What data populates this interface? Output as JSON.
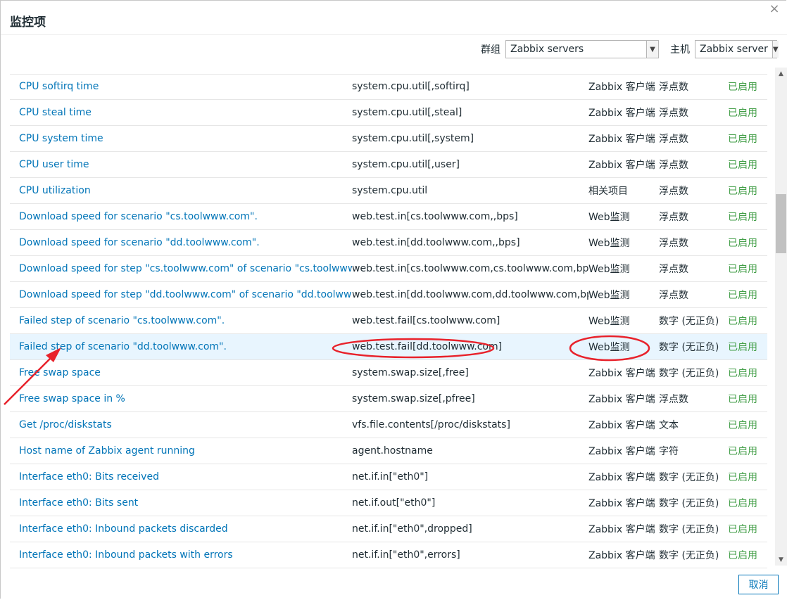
{
  "dialog": {
    "title": "监控项",
    "close_symbol": "×"
  },
  "filters": {
    "group_label": "群组",
    "group_value": "Zabbix servers",
    "host_label": "主机",
    "host_value": "Zabbix server"
  },
  "table": {
    "rows": [
      {
        "name": "CPU softirq time",
        "key": "system.cpu.util[,softirq]",
        "type": "Zabbix 客户端",
        "value_type": "浮点数",
        "status": "已启用"
      },
      {
        "name": "CPU steal time",
        "key": "system.cpu.util[,steal]",
        "type": "Zabbix 客户端",
        "value_type": "浮点数",
        "status": "已启用"
      },
      {
        "name": "CPU system time",
        "key": "system.cpu.util[,system]",
        "type": "Zabbix 客户端",
        "value_type": "浮点数",
        "status": "已启用"
      },
      {
        "name": "CPU user time",
        "key": "system.cpu.util[,user]",
        "type": "Zabbix 客户端",
        "value_type": "浮点数",
        "status": "已启用"
      },
      {
        "name": "CPU utilization",
        "key": "system.cpu.util",
        "type": "相关项目",
        "value_type": "浮点数",
        "status": "已启用"
      },
      {
        "name": "Download speed for scenario \"cs.toolwww.com\".",
        "key": "web.test.in[cs.toolwww.com,,bps]",
        "type": "Web监测",
        "value_type": "浮点数",
        "status": "已启用"
      },
      {
        "name": "Download speed for scenario \"dd.toolwww.com\".",
        "key": "web.test.in[dd.toolwww.com,,bps]",
        "type": "Web监测",
        "value_type": "浮点数",
        "status": "已启用"
      },
      {
        "name": "Download speed for step \"cs.toolwww.com\" of scenario \"cs.toolwww.com\".",
        "key": "web.test.in[cs.toolwww.com,cs.toolwww.com,bps]",
        "type": "Web监测",
        "value_type": "浮点数",
        "status": "已启用"
      },
      {
        "name": "Download speed for step \"dd.toolwww.com\" of scenario \"dd.toolwww.com\".",
        "key": "web.test.in[dd.toolwww.com,dd.toolwww.com,bps]",
        "type": "Web监测",
        "value_type": "浮点数",
        "status": "已启用"
      },
      {
        "name": "Failed step of scenario \"cs.toolwww.com\".",
        "key": "web.test.fail[cs.toolwww.com]",
        "type": "Web监测",
        "value_type": "数字 (无正负)",
        "status": "已启用"
      },
      {
        "name": "Failed step of scenario \"dd.toolwww.com\".",
        "key": "web.test.fail[dd.toolwww.com]",
        "type": "Web监测",
        "value_type": "数字 (无正负)",
        "status": "已启用"
      },
      {
        "name": "Free swap space",
        "key": "system.swap.size[,free]",
        "type": "Zabbix 客户端",
        "value_type": "数字 (无正负)",
        "status": "已启用"
      },
      {
        "name": "Free swap space in %",
        "key": "system.swap.size[,pfree]",
        "type": "Zabbix 客户端",
        "value_type": "浮点数",
        "status": "已启用"
      },
      {
        "name": "Get /proc/diskstats",
        "key": "vfs.file.contents[/proc/diskstats]",
        "type": "Zabbix 客户端",
        "value_type": "文本",
        "status": "已启用"
      },
      {
        "name": "Host name of Zabbix agent running",
        "key": "agent.hostname",
        "type": "Zabbix 客户端",
        "value_type": "字符",
        "status": "已启用"
      },
      {
        "name": "Interface eth0: Bits received",
        "key": "net.if.in[\"eth0\"]",
        "type": "Zabbix 客户端",
        "value_type": "数字 (无正负)",
        "status": "已启用"
      },
      {
        "name": "Interface eth0: Bits sent",
        "key": "net.if.out[\"eth0\"]",
        "type": "Zabbix 客户端",
        "value_type": "数字 (无正负)",
        "status": "已启用"
      },
      {
        "name": "Interface eth0: Inbound packets discarded",
        "key": "net.if.in[\"eth0\",dropped]",
        "type": "Zabbix 客户端",
        "value_type": "数字 (无正负)",
        "status": "已启用"
      },
      {
        "name": "Interface eth0: Inbound packets with errors",
        "key": "net.if.in[\"eth0\",errors]",
        "type": "Zabbix 客户端",
        "value_type": "数字 (无正负)",
        "status": "已启用"
      }
    ]
  },
  "footer": {
    "cancel_label": "取消"
  },
  "colors": {
    "link": "#0275b8",
    "enabled": "#429e47",
    "annotation": "#e8222b"
  }
}
